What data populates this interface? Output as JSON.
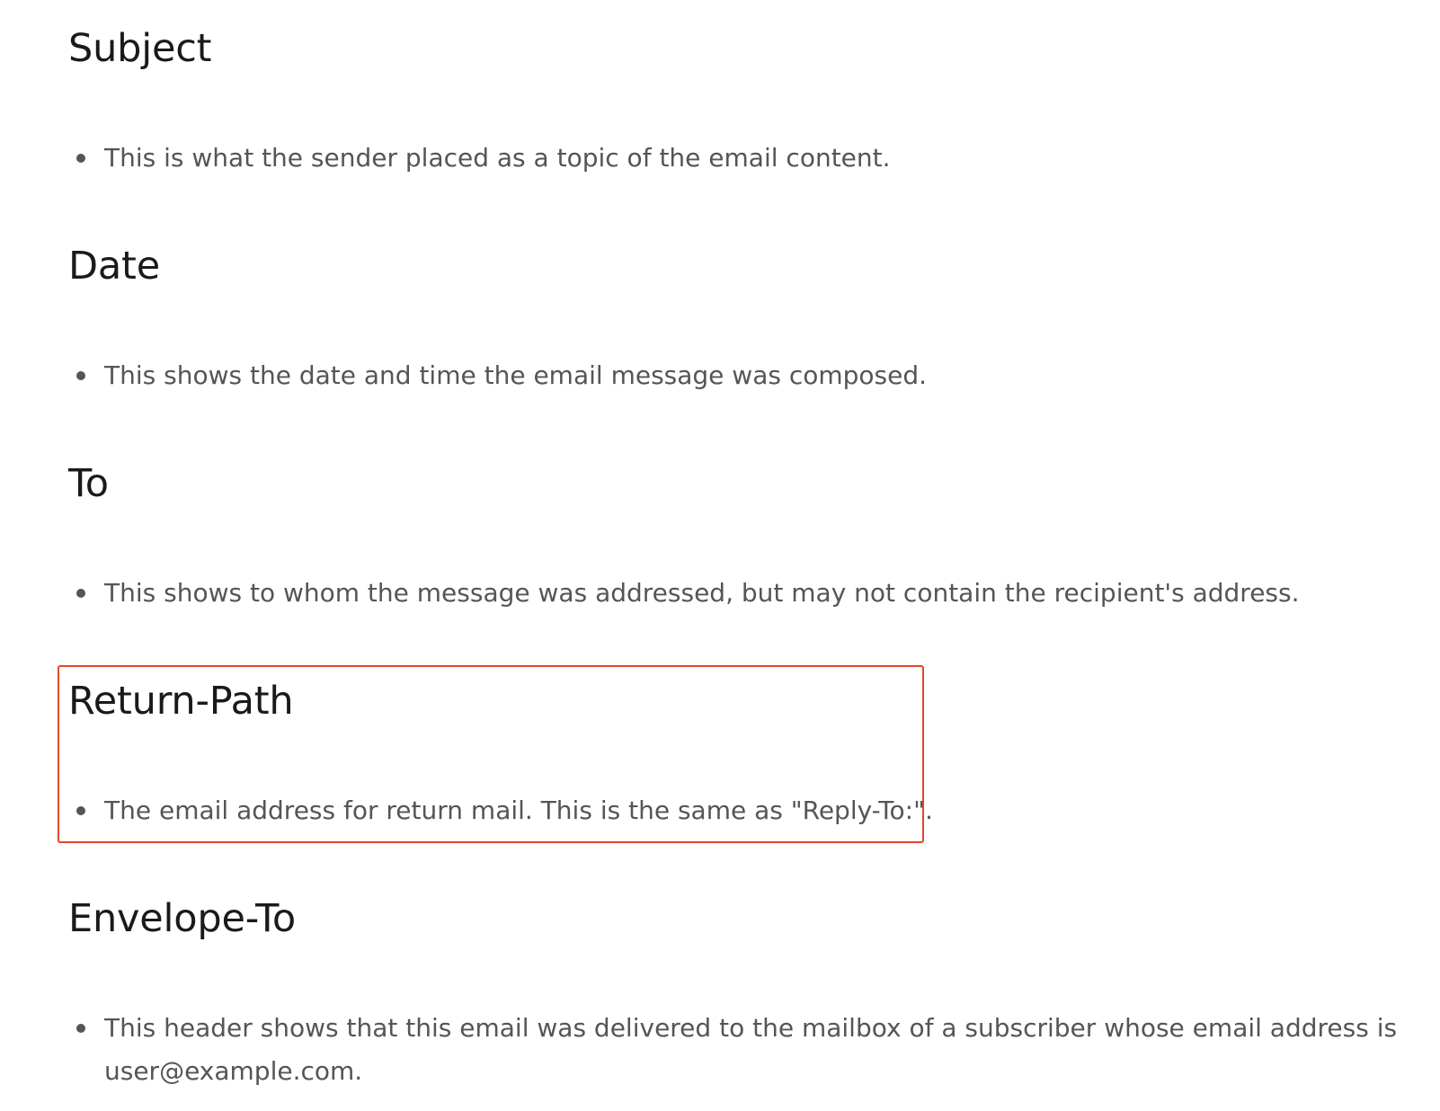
{
  "sections": [
    {
      "title": "Subject",
      "bullet": "This is what the sender placed as a topic of the email content."
    },
    {
      "title": "Date",
      "bullet": "This shows the date and time the email message was composed."
    },
    {
      "title": "To",
      "bullet": "This shows to whom the message was addressed, but may not contain the recipient's address."
    },
    {
      "title": "Return-Path",
      "bullet": "The email address for return mail. This is the same as \"Reply-To:\"."
    },
    {
      "title": "Envelope-To",
      "bullet": "This header shows that this email was delivered to the mailbox of a subscriber whose email address is user@example.com."
    }
  ],
  "colors": {
    "highlight_border": "#e0482b",
    "heading_text": "#1a1a1a",
    "body_text": "#555555"
  }
}
